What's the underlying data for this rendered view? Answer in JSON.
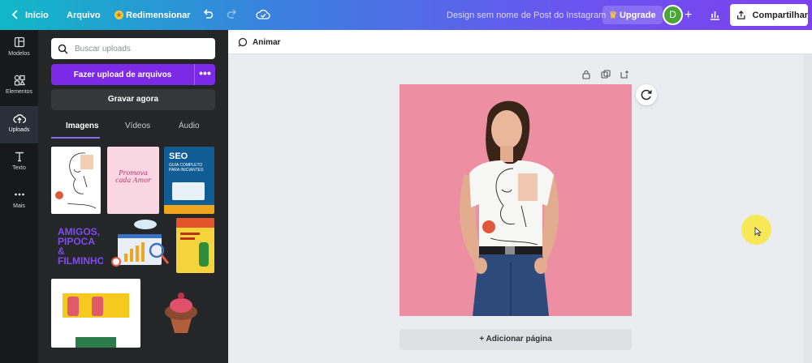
{
  "topbar": {
    "home": "Início",
    "file": "Arquivo",
    "resize": "Redimensionar",
    "doc_title": "Design sem nome de Post do Instagram",
    "upgrade": "Upgrade",
    "avatar_initial": "D",
    "share": "Compartilhar"
  },
  "rail": {
    "items": [
      {
        "label": "Modelos",
        "icon": "layout-icon"
      },
      {
        "label": "Elementos",
        "icon": "shapes-icon"
      },
      {
        "label": "Uploads",
        "icon": "cloud-upload-icon"
      },
      {
        "label": "Texto",
        "icon": "text-icon"
      },
      {
        "label": "Mais",
        "icon": "more-dots-icon"
      }
    ]
  },
  "panel": {
    "search_placeholder": "Buscar uploads",
    "upload_button": "Fazer upload de arquivos",
    "record_button": "Gravar agora",
    "tabs": [
      "Imagens",
      "Vídeos",
      "Áudio"
    ],
    "active_tab": "Imagens",
    "thumb_text": {
      "love": "Promova cada Amor",
      "seo_title": "SEO",
      "seo_sub": "GUIA COMPLETO PARA INICIANTES",
      "amigos": "AMIGOS, PIPOCA & FILMINHO."
    }
  },
  "toolbar": {
    "animate": "Animar"
  },
  "canvas": {
    "add_page": "+ Adicionar página"
  },
  "colors": {
    "accent": "#7d2ae8",
    "canvas_bg": "#ee8ea3",
    "rail_bg": "#17191c",
    "panel_bg": "#252627"
  }
}
